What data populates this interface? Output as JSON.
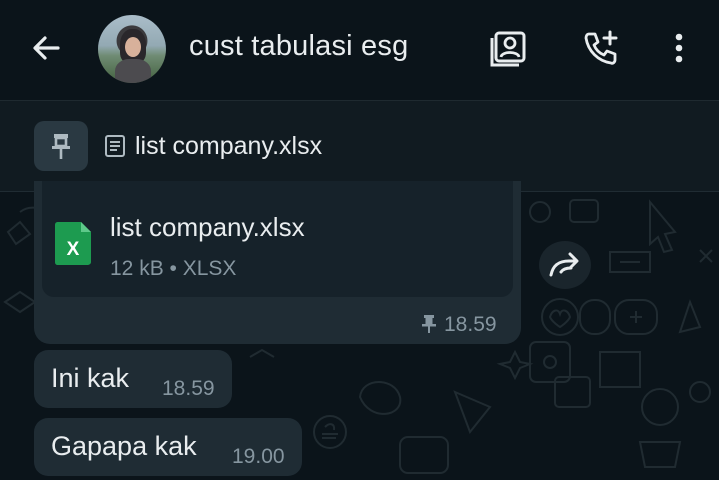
{
  "header": {
    "title": "cust tabulasi esg",
    "icons": [
      "back-arrow-icon",
      "avatar",
      "contact-card-icon",
      "add-call-icon",
      "more-vert-icon"
    ]
  },
  "pinned": {
    "icon": "pin-icon",
    "doc_icon": "document-icon",
    "text": "list company.xlsx"
  },
  "file_message": {
    "file_name": "list company.xlsx",
    "meta": "12 kB • XLSX",
    "time": "18.59",
    "file_icon_letter": "X"
  },
  "messages": [
    {
      "text": "Ini kak",
      "time": "18.59"
    },
    {
      "text": "Gapapa kak",
      "time": "19.00"
    }
  ],
  "colors": {
    "background": "#0b141a",
    "bubble": "#1f2c34",
    "text": "#e9edef",
    "muted": "#8696a0",
    "xlsx_green": "#1d9b50"
  }
}
